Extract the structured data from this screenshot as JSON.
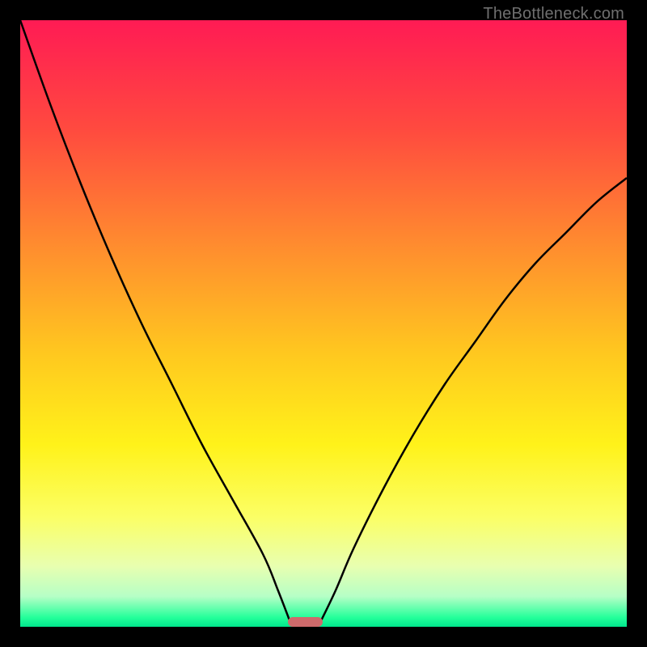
{
  "watermark": "TheBottleneck.com",
  "chart_data": {
    "type": "line",
    "title": "",
    "xlabel": "",
    "ylabel": "",
    "xlim": [
      0,
      100
    ],
    "ylim": [
      0,
      100
    ],
    "grid": false,
    "legend": false,
    "gradient_stops": [
      {
        "offset": 0.0,
        "color": "#ff1b54"
      },
      {
        "offset": 0.18,
        "color": "#ff4a3f"
      },
      {
        "offset": 0.38,
        "color": "#ff8f2e"
      },
      {
        "offset": 0.55,
        "color": "#ffc81f"
      },
      {
        "offset": 0.7,
        "color": "#fff21a"
      },
      {
        "offset": 0.82,
        "color": "#fbff66"
      },
      {
        "offset": 0.9,
        "color": "#e8ffb0"
      },
      {
        "offset": 0.95,
        "color": "#b6ffc6"
      },
      {
        "offset": 0.985,
        "color": "#23ff9a"
      },
      {
        "offset": 1.0,
        "color": "#00e58c"
      }
    ],
    "series": [
      {
        "name": "left-branch",
        "x": [
          0,
          5,
          10,
          15,
          20,
          25,
          30,
          35,
          40,
          42.5,
          44.5
        ],
        "values": [
          100,
          86,
          73,
          61,
          50,
          40,
          30,
          21,
          12,
          6,
          0.8
        ]
      },
      {
        "name": "right-branch",
        "x": [
          49.5,
          52,
          55,
          60,
          65,
          70,
          75,
          80,
          85,
          90,
          95,
          100
        ],
        "values": [
          0.8,
          6,
          13,
          23,
          32,
          40,
          47,
          54,
          60,
          65,
          70,
          74
        ]
      }
    ],
    "marker": {
      "x_start": 44.5,
      "x_end": 49.5,
      "y": 0.8,
      "color": "#ce6a6b"
    }
  }
}
